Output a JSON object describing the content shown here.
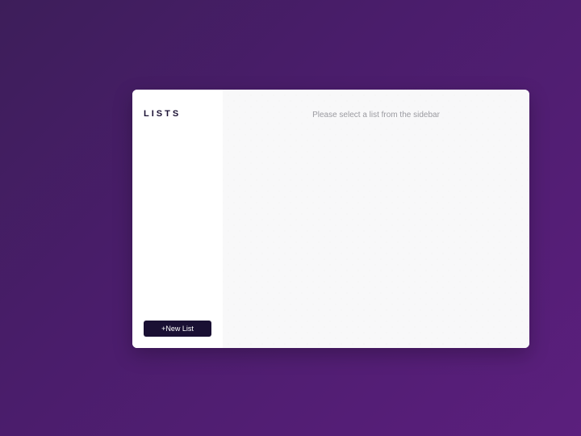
{
  "sidebar": {
    "title": "LISTS",
    "new_list_label": "+New List"
  },
  "main": {
    "empty_message": "Please select a list from the sidebar"
  }
}
